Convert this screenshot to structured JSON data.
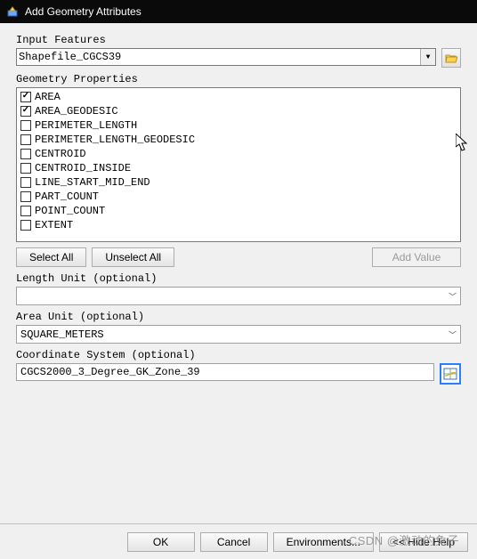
{
  "window": {
    "title": "Add Geometry Attributes"
  },
  "inputFeatures": {
    "label": "Input Features",
    "value": "Shapefile_CGCS39"
  },
  "geometryProperties": {
    "label": "Geometry Properties",
    "items": [
      {
        "label": "AREA",
        "checked": true
      },
      {
        "label": "AREA_GEODESIC",
        "checked": true
      },
      {
        "label": "PERIMETER_LENGTH",
        "checked": false
      },
      {
        "label": "PERIMETER_LENGTH_GEODESIC",
        "checked": false
      },
      {
        "label": "CENTROID",
        "checked": false
      },
      {
        "label": "CENTROID_INSIDE",
        "checked": false
      },
      {
        "label": "LINE_START_MID_END",
        "checked": false
      },
      {
        "label": "PART_COUNT",
        "checked": false
      },
      {
        "label": "POINT_COUNT",
        "checked": false
      },
      {
        "label": "EXTENT",
        "checked": false
      }
    ],
    "selectAll": "Select All",
    "unselectAll": "Unselect All",
    "addValue": "Add Value"
  },
  "lengthUnit": {
    "label": "Length Unit (optional)",
    "value": ""
  },
  "areaUnit": {
    "label": "Area Unit (optional)",
    "value": "SQUARE_METERS"
  },
  "coordinateSystem": {
    "label": "Coordinate System (optional)",
    "value": "CGCS2000_3_Degree_GK_Zone_39"
  },
  "footer": {
    "ok": "OK",
    "cancel": "Cancel",
    "environments": "Environments...",
    "hideHelp": "<< Hide Help"
  },
  "watermark": "CSDN @激动的兔子"
}
